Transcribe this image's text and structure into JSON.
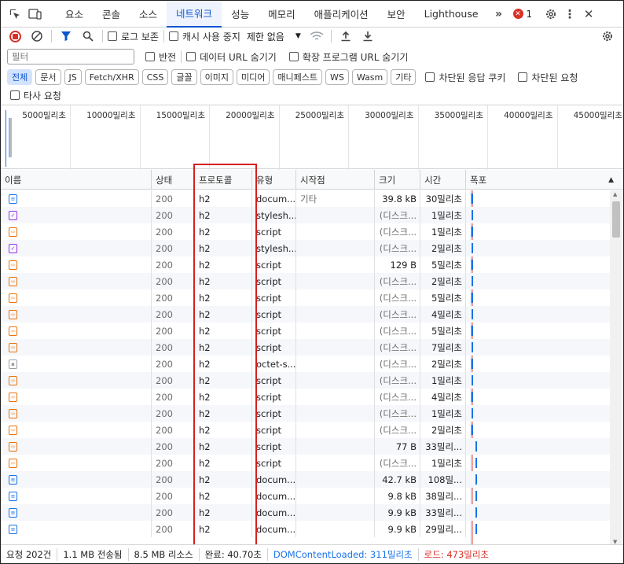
{
  "tabs": [
    "요소",
    "콘솔",
    "소스",
    "네트워크",
    "성능",
    "메모리",
    "애플리케이션",
    "보안",
    "Lighthouse"
  ],
  "active_tab": 3,
  "error_count": "1",
  "toolbar": {
    "preserve_log": "로그 보존",
    "disable_cache": "캐시 사용 중지",
    "throttle": "제한 없음"
  },
  "filter": {
    "placeholder": "필터",
    "invert": "반전",
    "hide_data_urls": "데이터 URL 숨기기",
    "hide_ext_urls": "확장 프로그램 URL 숨기기"
  },
  "type_chips": [
    "전체",
    "문서",
    "JS",
    "Fetch/XHR",
    "CSS",
    "글꼴",
    "이미지",
    "미디어",
    "매니페스트",
    "WS",
    "Wasm",
    "기타"
  ],
  "blocked_cookies": "차단된 응답 쿠키",
  "blocked_requests": "차단된 요청",
  "third_party": "타사 요청",
  "overview_ticks": [
    "5000밀리초",
    "10000밀리초",
    "15000밀리초",
    "20000밀리초",
    "25000밀리초",
    "30000밀리초",
    "35000밀리초",
    "40000밀리초",
    "45000밀리초"
  ],
  "columns": {
    "name": "이름",
    "status": "상태",
    "protocol": "프로토콜",
    "type": "유형",
    "initiator": "시작점",
    "size": "크기",
    "time": "시간",
    "waterfall": "폭포"
  },
  "rows": [
    {
      "icon": "doc",
      "status": "200",
      "protocol": "h2",
      "type": "docum...",
      "initiator": "기타",
      "size": "39.8 kB",
      "time": "30밀리초"
    },
    {
      "icon": "css",
      "status": "200",
      "protocol": "h2",
      "type": "stylesh...",
      "initiator": "",
      "size": "(디스크...",
      "time": "1밀리초"
    },
    {
      "icon": "js",
      "status": "200",
      "protocol": "h2",
      "type": "script",
      "initiator": "",
      "size": "(디스크...",
      "time": "1밀리초"
    },
    {
      "icon": "css",
      "status": "200",
      "protocol": "h2",
      "type": "stylesh...",
      "initiator": "",
      "size": "(디스크...",
      "time": "2밀리초"
    },
    {
      "icon": "js",
      "status": "200",
      "protocol": "h2",
      "type": "script",
      "initiator": "",
      "size": "129 B",
      "time": "5밀리초"
    },
    {
      "icon": "js",
      "status": "200",
      "protocol": "h2",
      "type": "script",
      "initiator": "",
      "size": "(디스크...",
      "time": "2밀리초"
    },
    {
      "icon": "js",
      "status": "200",
      "protocol": "h2",
      "type": "script",
      "initiator": "",
      "size": "(디스크...",
      "time": "5밀리초"
    },
    {
      "icon": "js",
      "status": "200",
      "protocol": "h2",
      "type": "script",
      "initiator": "",
      "size": "(디스크...",
      "time": "4밀리초"
    },
    {
      "icon": "js",
      "status": "200",
      "protocol": "h2",
      "type": "script",
      "initiator": "",
      "size": "(디스크...",
      "time": "5밀리초"
    },
    {
      "icon": "js",
      "status": "200",
      "protocol": "h2",
      "type": "script",
      "initiator": "",
      "size": "(디스크...",
      "time": "7밀리초"
    },
    {
      "icon": "other",
      "status": "200",
      "protocol": "h2",
      "type": "octet-s...",
      "initiator": "",
      "size": "(디스크...",
      "time": "2밀리초"
    },
    {
      "icon": "js",
      "status": "200",
      "protocol": "h2",
      "type": "script",
      "initiator": "",
      "size": "(디스크...",
      "time": "1밀리초"
    },
    {
      "icon": "js",
      "status": "200",
      "protocol": "h2",
      "type": "script",
      "initiator": "",
      "size": "(디스크...",
      "time": "4밀리초"
    },
    {
      "icon": "js",
      "status": "200",
      "protocol": "h2",
      "type": "script",
      "initiator": "",
      "size": "(디스크...",
      "time": "1밀리초"
    },
    {
      "icon": "js",
      "status": "200",
      "protocol": "h2",
      "type": "script",
      "initiator": "",
      "size": "(디스크...",
      "time": "2밀리초"
    },
    {
      "icon": "js",
      "status": "200",
      "protocol": "h2",
      "type": "script",
      "initiator": "",
      "size": "77 B",
      "time": "33밀리..."
    },
    {
      "icon": "js",
      "status": "200",
      "protocol": "h2",
      "type": "script",
      "initiator": "",
      "size": "(디스크...",
      "time": "1밀리초"
    },
    {
      "icon": "doc",
      "status": "200",
      "protocol": "h2",
      "type": "docum...",
      "initiator": "",
      "size": "42.7 kB",
      "time": "108밀..."
    },
    {
      "icon": "doc",
      "status": "200",
      "protocol": "h2",
      "type": "docum...",
      "initiator": "",
      "size": "9.8 kB",
      "time": "38밀리..."
    },
    {
      "icon": "doc",
      "status": "200",
      "protocol": "h2",
      "type": "docum...",
      "initiator": "",
      "size": "9.9 kB",
      "time": "33밀리..."
    },
    {
      "icon": "doc",
      "status": "200",
      "protocol": "h2",
      "type": "docum...",
      "initiator": "",
      "size": "9.9 kB",
      "time": "29밀리..."
    }
  ],
  "status_bar": {
    "requests": "요청 202건",
    "transferred": "1.1 MB 전송됨",
    "resources": "8.5 MB 리소스",
    "finish": "완료: 40.70초",
    "dcl": "DOMContentLoaded: 311밀리초",
    "load": "로드: 473밀리초"
  },
  "colors": {
    "accent": "#0b57d0",
    "error": "#d93025",
    "doc": "#1a73e8",
    "js": "#e8710a",
    "css": "#9334e6",
    "dcl": "#1a73e8",
    "load": "#d93025",
    "highlight": "#d62020"
  }
}
